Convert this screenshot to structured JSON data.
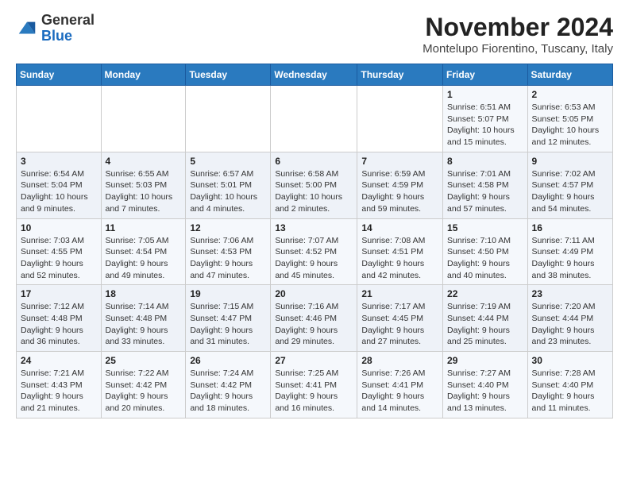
{
  "header": {
    "logo_general": "General",
    "logo_blue": "Blue",
    "title": "November 2024",
    "subtitle": "Montelupo Fiorentino, Tuscany, Italy"
  },
  "calendar": {
    "days_of_week": [
      "Sunday",
      "Monday",
      "Tuesday",
      "Wednesday",
      "Thursday",
      "Friday",
      "Saturday"
    ],
    "weeks": [
      [
        {
          "day": "",
          "info": ""
        },
        {
          "day": "",
          "info": ""
        },
        {
          "day": "",
          "info": ""
        },
        {
          "day": "",
          "info": ""
        },
        {
          "day": "",
          "info": ""
        },
        {
          "day": "1",
          "info": "Sunrise: 6:51 AM\nSunset: 5:07 PM\nDaylight: 10 hours and 15 minutes."
        },
        {
          "day": "2",
          "info": "Sunrise: 6:53 AM\nSunset: 5:05 PM\nDaylight: 10 hours and 12 minutes."
        }
      ],
      [
        {
          "day": "3",
          "info": "Sunrise: 6:54 AM\nSunset: 5:04 PM\nDaylight: 10 hours and 9 minutes."
        },
        {
          "day": "4",
          "info": "Sunrise: 6:55 AM\nSunset: 5:03 PM\nDaylight: 10 hours and 7 minutes."
        },
        {
          "day": "5",
          "info": "Sunrise: 6:57 AM\nSunset: 5:01 PM\nDaylight: 10 hours and 4 minutes."
        },
        {
          "day": "6",
          "info": "Sunrise: 6:58 AM\nSunset: 5:00 PM\nDaylight: 10 hours and 2 minutes."
        },
        {
          "day": "7",
          "info": "Sunrise: 6:59 AM\nSunset: 4:59 PM\nDaylight: 9 hours and 59 minutes."
        },
        {
          "day": "8",
          "info": "Sunrise: 7:01 AM\nSunset: 4:58 PM\nDaylight: 9 hours and 57 minutes."
        },
        {
          "day": "9",
          "info": "Sunrise: 7:02 AM\nSunset: 4:57 PM\nDaylight: 9 hours and 54 minutes."
        }
      ],
      [
        {
          "day": "10",
          "info": "Sunrise: 7:03 AM\nSunset: 4:55 PM\nDaylight: 9 hours and 52 minutes."
        },
        {
          "day": "11",
          "info": "Sunrise: 7:05 AM\nSunset: 4:54 PM\nDaylight: 9 hours and 49 minutes."
        },
        {
          "day": "12",
          "info": "Sunrise: 7:06 AM\nSunset: 4:53 PM\nDaylight: 9 hours and 47 minutes."
        },
        {
          "day": "13",
          "info": "Sunrise: 7:07 AM\nSunset: 4:52 PM\nDaylight: 9 hours and 45 minutes."
        },
        {
          "day": "14",
          "info": "Sunrise: 7:08 AM\nSunset: 4:51 PM\nDaylight: 9 hours and 42 minutes."
        },
        {
          "day": "15",
          "info": "Sunrise: 7:10 AM\nSunset: 4:50 PM\nDaylight: 9 hours and 40 minutes."
        },
        {
          "day": "16",
          "info": "Sunrise: 7:11 AM\nSunset: 4:49 PM\nDaylight: 9 hours and 38 minutes."
        }
      ],
      [
        {
          "day": "17",
          "info": "Sunrise: 7:12 AM\nSunset: 4:48 PM\nDaylight: 9 hours and 36 minutes."
        },
        {
          "day": "18",
          "info": "Sunrise: 7:14 AM\nSunset: 4:48 PM\nDaylight: 9 hours and 33 minutes."
        },
        {
          "day": "19",
          "info": "Sunrise: 7:15 AM\nSunset: 4:47 PM\nDaylight: 9 hours and 31 minutes."
        },
        {
          "day": "20",
          "info": "Sunrise: 7:16 AM\nSunset: 4:46 PM\nDaylight: 9 hours and 29 minutes."
        },
        {
          "day": "21",
          "info": "Sunrise: 7:17 AM\nSunset: 4:45 PM\nDaylight: 9 hours and 27 minutes."
        },
        {
          "day": "22",
          "info": "Sunrise: 7:19 AM\nSunset: 4:44 PM\nDaylight: 9 hours and 25 minutes."
        },
        {
          "day": "23",
          "info": "Sunrise: 7:20 AM\nSunset: 4:44 PM\nDaylight: 9 hours and 23 minutes."
        }
      ],
      [
        {
          "day": "24",
          "info": "Sunrise: 7:21 AM\nSunset: 4:43 PM\nDaylight: 9 hours and 21 minutes."
        },
        {
          "day": "25",
          "info": "Sunrise: 7:22 AM\nSunset: 4:42 PM\nDaylight: 9 hours and 20 minutes."
        },
        {
          "day": "26",
          "info": "Sunrise: 7:24 AM\nSunset: 4:42 PM\nDaylight: 9 hours and 18 minutes."
        },
        {
          "day": "27",
          "info": "Sunrise: 7:25 AM\nSunset: 4:41 PM\nDaylight: 9 hours and 16 minutes."
        },
        {
          "day": "28",
          "info": "Sunrise: 7:26 AM\nSunset: 4:41 PM\nDaylight: 9 hours and 14 minutes."
        },
        {
          "day": "29",
          "info": "Sunrise: 7:27 AM\nSunset: 4:40 PM\nDaylight: 9 hours and 13 minutes."
        },
        {
          "day": "30",
          "info": "Sunrise: 7:28 AM\nSunset: 4:40 PM\nDaylight: 9 hours and 11 minutes."
        }
      ]
    ]
  }
}
